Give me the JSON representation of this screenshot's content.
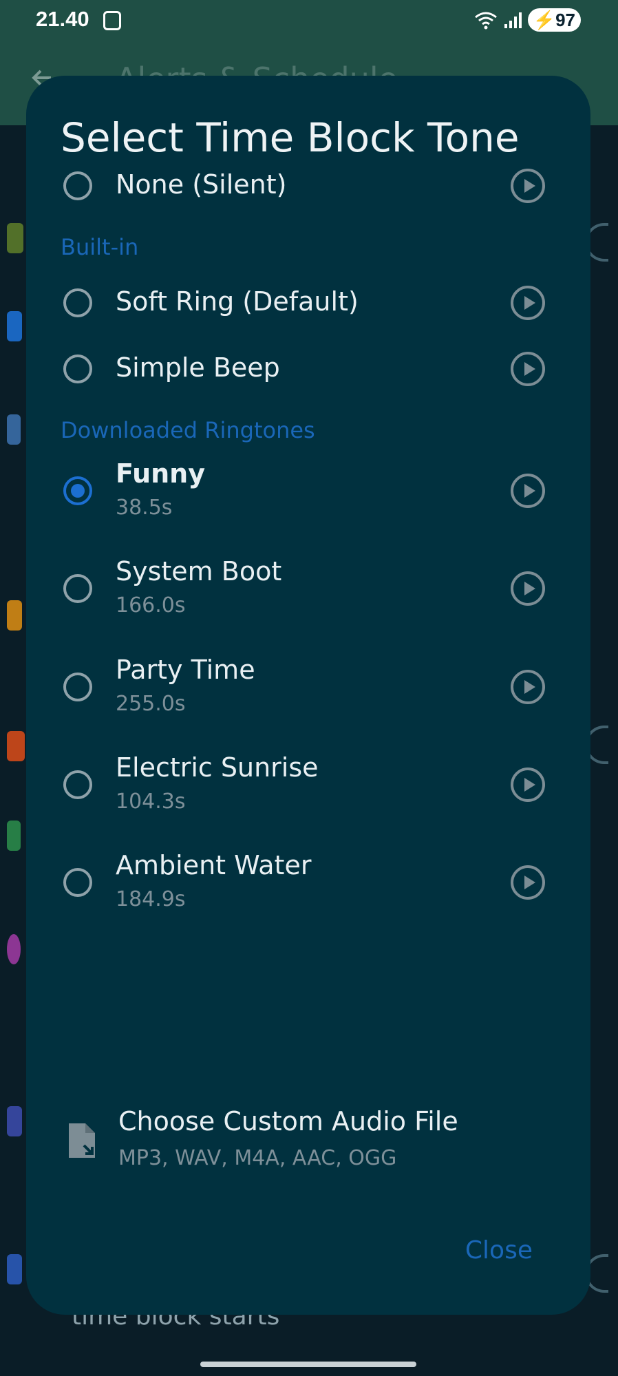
{
  "status_bar": {
    "time": "21.40",
    "battery": "97"
  },
  "background": {
    "title": "Alerts & Schedule",
    "caption": "time block starts"
  },
  "dialog": {
    "title": "Select Time Block Tone",
    "none_option": {
      "label": "None (Silent)"
    },
    "builtin_section": "Built-in",
    "builtin_options": [
      {
        "label": "Soft Ring (Default)"
      },
      {
        "label": "Simple Beep"
      }
    ],
    "downloaded_section": "Downloaded Ringtones",
    "downloaded_options": [
      {
        "label": "Funny",
        "duration": "38.5s",
        "selected": true
      },
      {
        "label": "System Boot",
        "duration": "166.0s"
      },
      {
        "label": "Party Time",
        "duration": "255.0s"
      },
      {
        "label": "Electric Sunrise",
        "duration": "104.3s"
      },
      {
        "label": "Ambient Water",
        "duration": "184.9s"
      }
    ],
    "custom": {
      "title": "Choose Custom Audio File",
      "formats": "MP3, WAV, M4A, AAC, OGG"
    },
    "close_label": "Close"
  },
  "colors": {
    "dialog_bg": "#01313f",
    "accent": "#1a67b8",
    "header_bg": "#1f4f45"
  },
  "icons": [
    "screenshot-icon",
    "wifi-icon",
    "signal-icon",
    "battery-icon",
    "back-arrow-icon",
    "play-icon",
    "audio-file-icon"
  ]
}
